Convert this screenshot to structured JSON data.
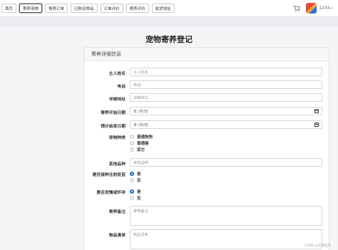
{
  "nav": {
    "tabs": [
      "首页",
      "寄养宠物",
      "寄养订单",
      "已购买物品",
      "订单评价",
      "寄养评价",
      "收货地址"
    ],
    "active_tab": "寄养宠物"
  },
  "user": {
    "name": "1234",
    "caret": "▾"
  },
  "icons": {
    "cart": "cart-icon",
    "avatar": "avatar-image",
    "calendar": "calendar-icon"
  },
  "page": {
    "title": "宠物寄养登记"
  },
  "card": {
    "title": "寄养详细信息"
  },
  "form": {
    "owner_name": {
      "label": "主人姓名",
      "placeholder": "主人姓名"
    },
    "phone": {
      "label": "电话",
      "placeholder": "电话"
    },
    "address": {
      "label": "详细地址",
      "placeholder": "详细地址"
    },
    "start_date": {
      "label": "寄养开始日期",
      "value": "年 /月/日"
    },
    "end_date": {
      "label": "预计结束日期",
      "value": "年 /月/日"
    },
    "pet_type": {
      "label": "宠物种类",
      "options": [
        "普通狗狗",
        "普通猫",
        "其它"
      ]
    },
    "other_breed": {
      "label": "其他品种",
      "placeholder": "其他品种"
    },
    "vaccinated": {
      "label": "是否接种注射疫苗",
      "options": [
        "是",
        "否"
      ],
      "selected": "是"
    },
    "in_heat": {
      "label": "是否发情或怀孕",
      "options": [
        "是",
        "否"
      ],
      "selected": "是"
    },
    "remarks": {
      "label": "寄养备注",
      "placeholder": "寄养备注"
    },
    "items": {
      "label": "物品清单",
      "placeholder": "物品清单"
    }
  },
  "colors": {
    "accent": "#1e6bd6",
    "background": "#f4f5f7"
  },
  "watermark": "CSDN @毕课程序"
}
